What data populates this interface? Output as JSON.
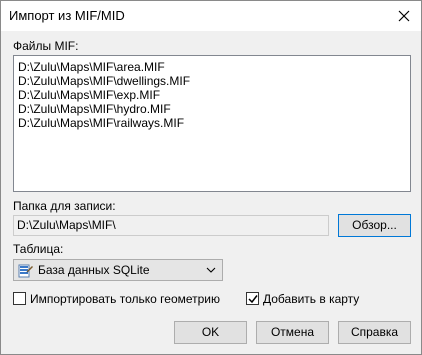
{
  "window": {
    "title": "Импорт из MIF/MID"
  },
  "files": {
    "label": "Файлы MIF:",
    "items": [
      "D:\\Zulu\\Maps\\MIF\\area.MIF",
      "D:\\Zulu\\Maps\\MIF\\dwellings.MIF",
      "D:\\Zulu\\Maps\\MIF\\exp.MIF",
      "D:\\Zulu\\Maps\\MIF\\hydro.MIF",
      "D:\\Zulu\\Maps\\MIF\\railways.MIF"
    ]
  },
  "folder": {
    "label": "Папка для записи:",
    "value": "D:\\Zulu\\Maps\\MIF\\",
    "browse_label": "Обзор..."
  },
  "table": {
    "label": "Таблица:",
    "selected": "База данных SQLite",
    "icon": "database-icon"
  },
  "options": {
    "geometry_only": {
      "label": "Импортировать только геометрию",
      "checked": false
    },
    "add_to_map": {
      "label": "Добавить в карту",
      "checked": true
    }
  },
  "buttons": {
    "ok": "OK",
    "cancel": "Отмена",
    "help": "Справка"
  },
  "colors": {
    "focus_border": "#0078d7",
    "window_bg": "#f0f0f0"
  }
}
